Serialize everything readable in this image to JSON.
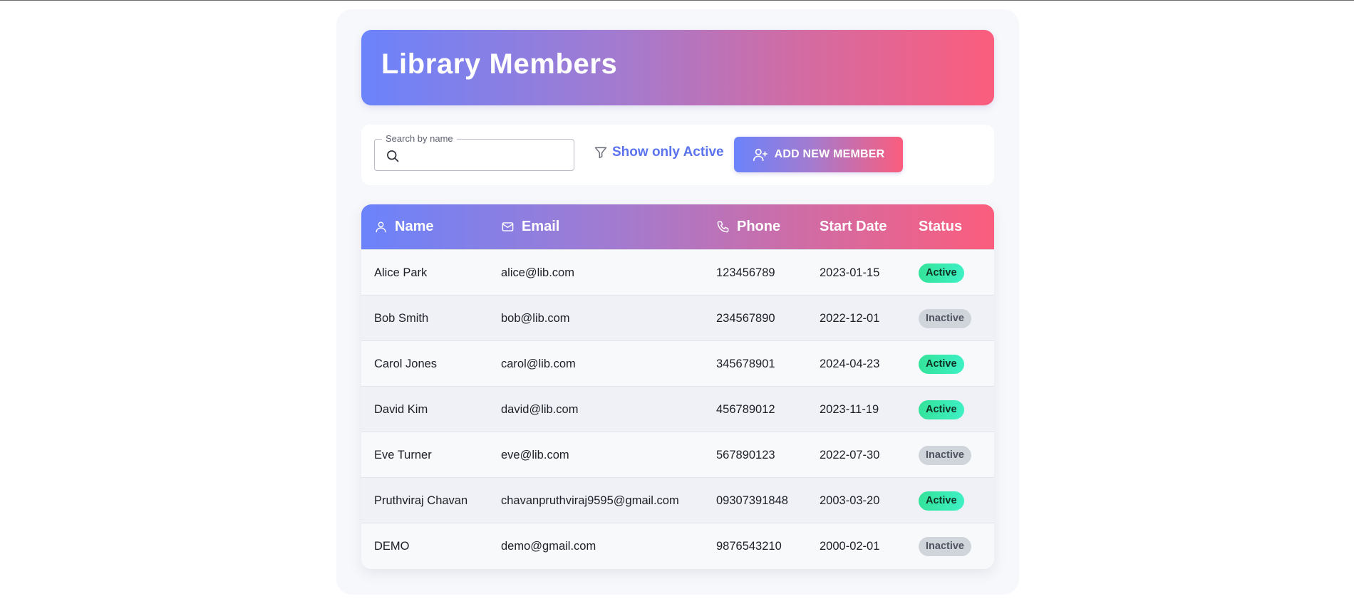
{
  "header": {
    "title": "Library Members"
  },
  "toolbar": {
    "search": {
      "label": "Search by name",
      "value": "",
      "placeholder": ""
    },
    "filter_label": "Show only Active",
    "add_label": "ADD NEW MEMBER"
  },
  "table": {
    "columns": {
      "name": "Name",
      "email": "Email",
      "phone": "Phone",
      "start_date": "Start Date",
      "status": "Status"
    },
    "rows": [
      {
        "name": "Alice Park",
        "email": "alice@lib.com",
        "phone": "123456789",
        "start_date": "2023-01-15",
        "status": "Active"
      },
      {
        "name": "Bob Smith",
        "email": "bob@lib.com",
        "phone": "234567890",
        "start_date": "2022-12-01",
        "status": "Inactive"
      },
      {
        "name": "Carol Jones",
        "email": "carol@lib.com",
        "phone": "345678901",
        "start_date": "2024-04-23",
        "status": "Active"
      },
      {
        "name": "David Kim",
        "email": "david@lib.com",
        "phone": "456789012",
        "start_date": "2023-11-19",
        "status": "Active"
      },
      {
        "name": "Eve Turner",
        "email": "eve@lib.com",
        "phone": "567890123",
        "start_date": "2022-07-30",
        "status": "Inactive"
      },
      {
        "name": "Pruthviraj Chavan",
        "email": "chavanpruthviraj9595@gmail.com",
        "phone": "09307391848",
        "start_date": "2003-03-20",
        "status": "Active"
      },
      {
        "name": "DEMO",
        "email": "demo@gmail.com",
        "phone": "9876543210",
        "start_date": "2000-02-01",
        "status": "Inactive"
      }
    ]
  },
  "colors": {
    "gradient_start": "#6b83fb",
    "gradient_end": "#fb5d7d",
    "accent_text": "#5b73ee",
    "active_badge": "#34e39a",
    "inactive_badge": "#cfd5da"
  },
  "icons": {
    "search": "search-icon",
    "filter": "filter-icon",
    "add_user": "add-user-icon",
    "user": "user-icon",
    "mail": "mail-icon",
    "phone": "phone-icon"
  }
}
